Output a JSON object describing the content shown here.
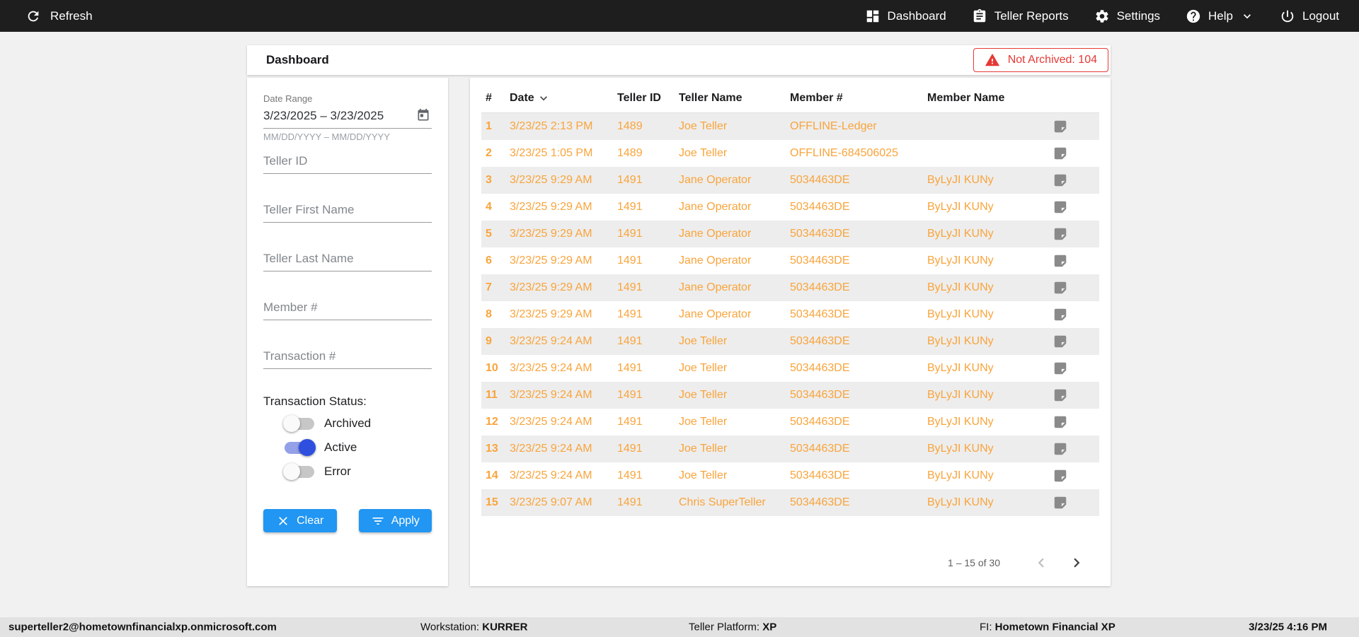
{
  "colors": {
    "topbar-bg": "#1e1e1e",
    "orange": "#f9a43b",
    "blue": "#2196f3",
    "red": "#e53935",
    "toggle-on-thumb": "#2f4fde",
    "toggle-on-track": "#94a0e8",
    "footer-bg": "#e2e2e2"
  },
  "topbar": {
    "refresh_label": "Refresh",
    "nav": [
      {
        "label": "Dashboard",
        "icon": "dashboard-icon"
      },
      {
        "label": "Teller Reports",
        "icon": "teller-reports-icon"
      },
      {
        "label": "Settings",
        "icon": "settings-icon"
      },
      {
        "label": "Help",
        "icon": "help-icon",
        "has_dropdown": true
      },
      {
        "label": "Logout",
        "icon": "logout-icon"
      }
    ]
  },
  "header": {
    "title": "Dashboard",
    "not_archived_badge": "Not Archived: 104"
  },
  "filters": {
    "date_range": {
      "label": "Date Range",
      "value": "3/23/2025 – 3/23/2025",
      "helper": "MM/DD/YYYY – MM/DD/YYYY"
    },
    "fields": [
      {
        "name": "teller-id-input",
        "placeholder": "Teller ID"
      },
      {
        "name": "teller-first-name-input",
        "placeholder": "Teller First Name"
      },
      {
        "name": "teller-last-name-input",
        "placeholder": "Teller Last Name"
      },
      {
        "name": "member-number-input",
        "placeholder": "Member #"
      },
      {
        "name": "transaction-number-input",
        "placeholder": "Transaction #"
      }
    ],
    "status": {
      "label": "Transaction Status:",
      "toggles": [
        {
          "label": "Archived",
          "on": false
        },
        {
          "label": "Active",
          "on": true
        },
        {
          "label": "Error",
          "on": false
        }
      ]
    },
    "clear_label": "Clear",
    "apply_label": "Apply"
  },
  "table": {
    "columns": [
      "#",
      "Date",
      "Teller ID",
      "Teller Name",
      "Member #",
      "Member Name"
    ],
    "sort_column": "Date",
    "rows": [
      {
        "num": "1",
        "date": "3/23/25 2:13 PM",
        "teller_id": "1489",
        "teller_name": "Joe Teller",
        "member_num": "OFFLINE-Ledger",
        "member_name": ""
      },
      {
        "num": "2",
        "date": "3/23/25 1:05 PM",
        "teller_id": "1489",
        "teller_name": "Joe Teller",
        "member_num": "OFFLINE-684506025",
        "member_name": ""
      },
      {
        "num": "3",
        "date": "3/23/25 9:29 AM",
        "teller_id": "1491",
        "teller_name": "Jane Operator",
        "member_num": "5034463DE",
        "member_name": "ByLyJI KUNy"
      },
      {
        "num": "4",
        "date": "3/23/25 9:29 AM",
        "teller_id": "1491",
        "teller_name": "Jane Operator",
        "member_num": "5034463DE",
        "member_name": "ByLyJI KUNy"
      },
      {
        "num": "5",
        "date": "3/23/25 9:29 AM",
        "teller_id": "1491",
        "teller_name": "Jane Operator",
        "member_num": "5034463DE",
        "member_name": "ByLyJI KUNy"
      },
      {
        "num": "6",
        "date": "3/23/25 9:29 AM",
        "teller_id": "1491",
        "teller_name": "Jane Operator",
        "member_num": "5034463DE",
        "member_name": "ByLyJI KUNy"
      },
      {
        "num": "7",
        "date": "3/23/25 9:29 AM",
        "teller_id": "1491",
        "teller_name": "Jane Operator",
        "member_num": "5034463DE",
        "member_name": "ByLyJI KUNy"
      },
      {
        "num": "8",
        "date": "3/23/25 9:29 AM",
        "teller_id": "1491",
        "teller_name": "Jane Operator",
        "member_num": "5034463DE",
        "member_name": "ByLyJI KUNy"
      },
      {
        "num": "9",
        "date": "3/23/25 9:24 AM",
        "teller_id": "1491",
        "teller_name": "Joe Teller",
        "member_num": "5034463DE",
        "member_name": "ByLyJI KUNy"
      },
      {
        "num": "10",
        "date": "3/23/25 9:24 AM",
        "teller_id": "1491",
        "teller_name": "Joe Teller",
        "member_num": "5034463DE",
        "member_name": "ByLyJI KUNy"
      },
      {
        "num": "11",
        "date": "3/23/25 9:24 AM",
        "teller_id": "1491",
        "teller_name": "Joe Teller",
        "member_num": "5034463DE",
        "member_name": "ByLyJI KUNy"
      },
      {
        "num": "12",
        "date": "3/23/25 9:24 AM",
        "teller_id": "1491",
        "teller_name": "Joe Teller",
        "member_num": "5034463DE",
        "member_name": "ByLyJI KUNy"
      },
      {
        "num": "13",
        "date": "3/23/25 9:24 AM",
        "teller_id": "1491",
        "teller_name": "Joe Teller",
        "member_num": "5034463DE",
        "member_name": "ByLyJI KUNy"
      },
      {
        "num": "14",
        "date": "3/23/25 9:24 AM",
        "teller_id": "1491",
        "teller_name": "Joe Teller",
        "member_num": "5034463DE",
        "member_name": "ByLyJI KUNy"
      },
      {
        "num": "15",
        "date": "3/23/25 9:07 AM",
        "teller_id": "1491",
        "teller_name": "Chris SuperTeller",
        "member_num": "5034463DE",
        "member_name": "ByLyJI KUNy"
      }
    ],
    "pagination": {
      "range": "1 – 15 of 30"
    }
  },
  "footer": {
    "user": "superteller2@hometownfinancialxp.onmicrosoft.com",
    "workstation_label": "Workstation:",
    "workstation_value": "KURRER",
    "platform_label": "Teller Platform:",
    "platform_value": "XP",
    "fi_label": "FI:",
    "fi_value": "Hometown Financial XP",
    "datetime": "3/23/25 4:16 PM"
  }
}
